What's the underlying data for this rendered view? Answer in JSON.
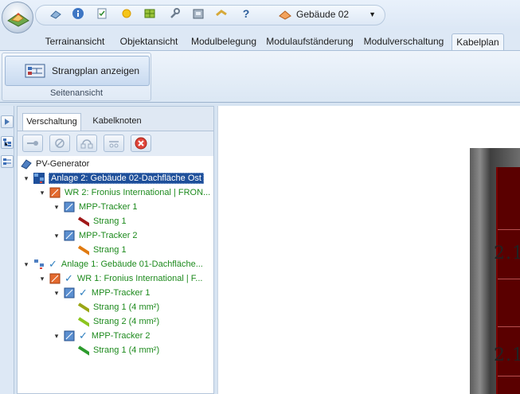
{
  "building_selector": {
    "value": "Gebäude 02"
  },
  "tabs": [
    {
      "label": "Terrainansicht"
    },
    {
      "label": "Objektansicht"
    },
    {
      "label": "Modulbelegung"
    },
    {
      "label": "Modulaufständerung"
    },
    {
      "label": "Modulverschaltung"
    },
    {
      "label": "Kabelplan",
      "active": true
    }
  ],
  "ribbon": {
    "button_label": "Strangplan anzeigen",
    "group_label": "Seitenansicht"
  },
  "panel": {
    "tabs": [
      {
        "label": "Verschaltung",
        "active": true
      },
      {
        "label": "Kabelknoten"
      }
    ]
  },
  "tree": {
    "root": "PV-Generator",
    "anlage2": "Anlage 2:  Gebäude 02-Dachfläche Ost",
    "wr2": "WR 2: Fronius International | FRON...",
    "wr2_mpp1": "MPP-Tracker 1",
    "wr2_mpp1_s1": "Strang 1",
    "wr2_mpp2": "MPP-Tracker 2",
    "wr2_mpp2_s1": "Strang 1",
    "anlage1": "Anlage 1:  Gebäude 01-Dachfläche...",
    "wr1": "WR 1: Fronius International | F...",
    "wr1_mpp1": "MPP-Tracker 1",
    "wr1_mpp1_s1": "Strang 1 (4 mm²)",
    "wr1_mpp1_s2": "Strang 2 (4 mm²)",
    "wr1_mpp2": "MPP-Tracker 2",
    "wr1_mpp2_s1": "Strang 1 (4 mm²)"
  },
  "canvas": {
    "label_top": "2.1",
    "label_bottom": "2.1"
  },
  "colors": {
    "selection": "#1e4f9a",
    "tree_text_green": "#1d8a1d",
    "check_blue": "#2f7fbf",
    "strang_red": "#a01818",
    "strang_orange": "#e07a10",
    "strang_olive": "#9aa615",
    "strang_lime": "#8cc51e",
    "strang_green": "#2d9b2d"
  }
}
